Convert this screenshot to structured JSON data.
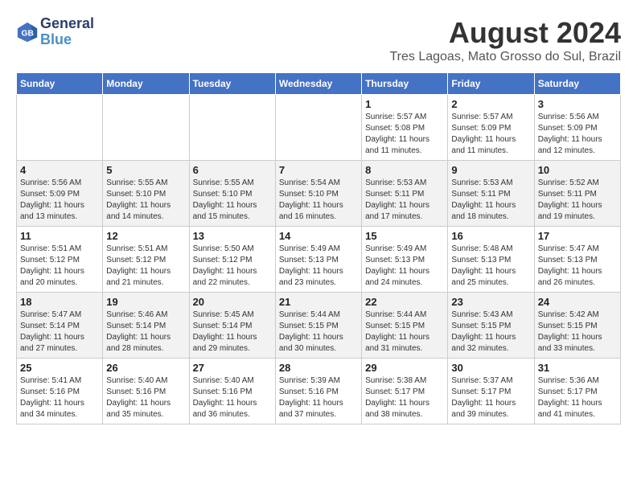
{
  "header": {
    "logo_line1": "General",
    "logo_line2": "Blue",
    "month_year": "August 2024",
    "location": "Tres Lagoas, Mato Grosso do Sul, Brazil"
  },
  "days_of_week": [
    "Sunday",
    "Monday",
    "Tuesday",
    "Wednesday",
    "Thursday",
    "Friday",
    "Saturday"
  ],
  "weeks": [
    [
      {
        "day": "",
        "info": ""
      },
      {
        "day": "",
        "info": ""
      },
      {
        "day": "",
        "info": ""
      },
      {
        "day": "",
        "info": ""
      },
      {
        "day": "1",
        "info": "Sunrise: 5:57 AM\nSunset: 5:08 PM\nDaylight: 11 hours and 11 minutes."
      },
      {
        "day": "2",
        "info": "Sunrise: 5:57 AM\nSunset: 5:09 PM\nDaylight: 11 hours and 11 minutes."
      },
      {
        "day": "3",
        "info": "Sunrise: 5:56 AM\nSunset: 5:09 PM\nDaylight: 11 hours and 12 minutes."
      }
    ],
    [
      {
        "day": "4",
        "info": "Sunrise: 5:56 AM\nSunset: 5:09 PM\nDaylight: 11 hours and 13 minutes."
      },
      {
        "day": "5",
        "info": "Sunrise: 5:55 AM\nSunset: 5:10 PM\nDaylight: 11 hours and 14 minutes."
      },
      {
        "day": "6",
        "info": "Sunrise: 5:55 AM\nSunset: 5:10 PM\nDaylight: 11 hours and 15 minutes."
      },
      {
        "day": "7",
        "info": "Sunrise: 5:54 AM\nSunset: 5:10 PM\nDaylight: 11 hours and 16 minutes."
      },
      {
        "day": "8",
        "info": "Sunrise: 5:53 AM\nSunset: 5:11 PM\nDaylight: 11 hours and 17 minutes."
      },
      {
        "day": "9",
        "info": "Sunrise: 5:53 AM\nSunset: 5:11 PM\nDaylight: 11 hours and 18 minutes."
      },
      {
        "day": "10",
        "info": "Sunrise: 5:52 AM\nSunset: 5:11 PM\nDaylight: 11 hours and 19 minutes."
      }
    ],
    [
      {
        "day": "11",
        "info": "Sunrise: 5:51 AM\nSunset: 5:12 PM\nDaylight: 11 hours and 20 minutes."
      },
      {
        "day": "12",
        "info": "Sunrise: 5:51 AM\nSunset: 5:12 PM\nDaylight: 11 hours and 21 minutes."
      },
      {
        "day": "13",
        "info": "Sunrise: 5:50 AM\nSunset: 5:12 PM\nDaylight: 11 hours and 22 minutes."
      },
      {
        "day": "14",
        "info": "Sunrise: 5:49 AM\nSunset: 5:13 PM\nDaylight: 11 hours and 23 minutes."
      },
      {
        "day": "15",
        "info": "Sunrise: 5:49 AM\nSunset: 5:13 PM\nDaylight: 11 hours and 24 minutes."
      },
      {
        "day": "16",
        "info": "Sunrise: 5:48 AM\nSunset: 5:13 PM\nDaylight: 11 hours and 25 minutes."
      },
      {
        "day": "17",
        "info": "Sunrise: 5:47 AM\nSunset: 5:13 PM\nDaylight: 11 hours and 26 minutes."
      }
    ],
    [
      {
        "day": "18",
        "info": "Sunrise: 5:47 AM\nSunset: 5:14 PM\nDaylight: 11 hours and 27 minutes."
      },
      {
        "day": "19",
        "info": "Sunrise: 5:46 AM\nSunset: 5:14 PM\nDaylight: 11 hours and 28 minutes."
      },
      {
        "day": "20",
        "info": "Sunrise: 5:45 AM\nSunset: 5:14 PM\nDaylight: 11 hours and 29 minutes."
      },
      {
        "day": "21",
        "info": "Sunrise: 5:44 AM\nSunset: 5:15 PM\nDaylight: 11 hours and 30 minutes."
      },
      {
        "day": "22",
        "info": "Sunrise: 5:44 AM\nSunset: 5:15 PM\nDaylight: 11 hours and 31 minutes."
      },
      {
        "day": "23",
        "info": "Sunrise: 5:43 AM\nSunset: 5:15 PM\nDaylight: 11 hours and 32 minutes."
      },
      {
        "day": "24",
        "info": "Sunrise: 5:42 AM\nSunset: 5:15 PM\nDaylight: 11 hours and 33 minutes."
      }
    ],
    [
      {
        "day": "25",
        "info": "Sunrise: 5:41 AM\nSunset: 5:16 PM\nDaylight: 11 hours and 34 minutes."
      },
      {
        "day": "26",
        "info": "Sunrise: 5:40 AM\nSunset: 5:16 PM\nDaylight: 11 hours and 35 minutes."
      },
      {
        "day": "27",
        "info": "Sunrise: 5:40 AM\nSunset: 5:16 PM\nDaylight: 11 hours and 36 minutes."
      },
      {
        "day": "28",
        "info": "Sunrise: 5:39 AM\nSunset: 5:16 PM\nDaylight: 11 hours and 37 minutes."
      },
      {
        "day": "29",
        "info": "Sunrise: 5:38 AM\nSunset: 5:17 PM\nDaylight: 11 hours and 38 minutes."
      },
      {
        "day": "30",
        "info": "Sunrise: 5:37 AM\nSunset: 5:17 PM\nDaylight: 11 hours and 39 minutes."
      },
      {
        "day": "31",
        "info": "Sunrise: 5:36 AM\nSunset: 5:17 PM\nDaylight: 11 hours and 41 minutes."
      }
    ]
  ]
}
